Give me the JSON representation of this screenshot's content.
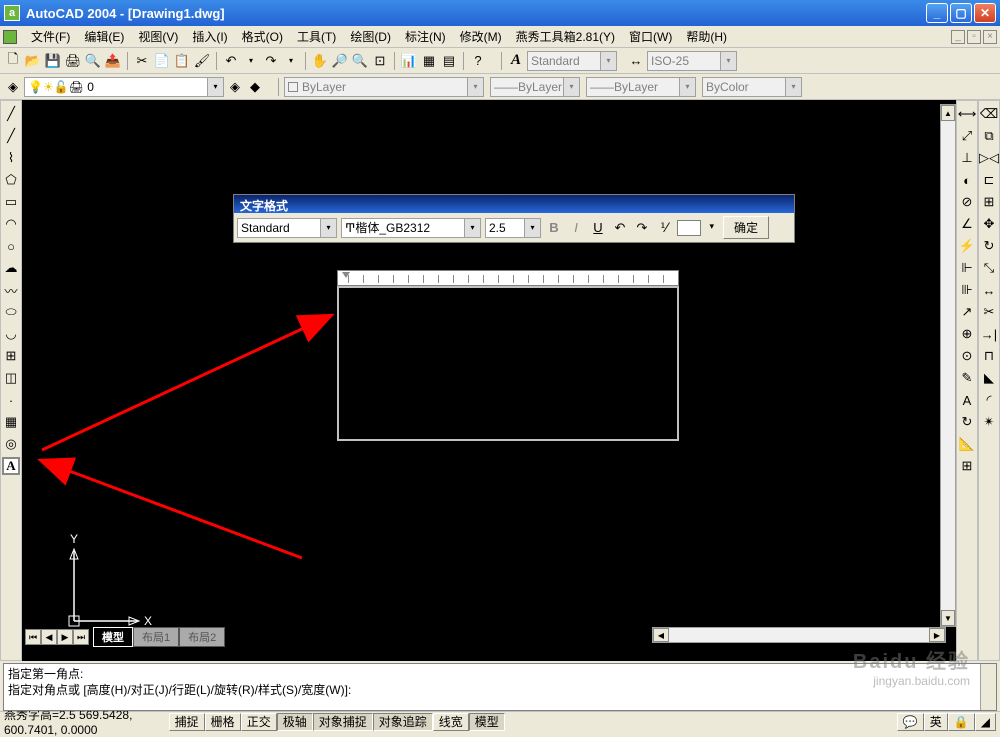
{
  "title": "AutoCAD 2004 - [Drawing1.dwg]",
  "menu": [
    "文件(F)",
    "编辑(E)",
    "视图(V)",
    "插入(I)",
    "格式(O)",
    "工具(T)",
    "绘图(D)",
    "标注(N)",
    "修改(M)",
    "燕秀工具箱2.81(Y)",
    "窗口(W)",
    "帮助(H)"
  ],
  "toolbar1_icons": [
    "new",
    "open",
    "save",
    "print",
    "preview",
    "spell",
    "cut",
    "copy",
    "paste",
    "match",
    "eraser",
    "|",
    "undo",
    "redo",
    "|",
    "pan",
    "zoom-rt",
    "zoom-prev",
    "zoom-win",
    "|",
    "prop",
    "dc",
    "tp",
    "|",
    "help"
  ],
  "style_combo": "Standard",
  "dim_combo": "ISO-25",
  "layer_row": {
    "current": "0",
    "combos": [
      "ByLayer",
      "ByLayer",
      "ByLayer",
      "ByColor"
    ]
  },
  "left_tools": [
    "line",
    "xline",
    "pline",
    "polygon",
    "rect",
    "arc",
    "circle",
    "revcloud",
    "spline",
    "ellipse",
    "ellipse-arc",
    "insert",
    "block",
    "point",
    "hatch",
    "region",
    "table",
    "mtext"
  ],
  "right_tools1": [
    "dist",
    "area",
    "mass",
    "list",
    "id",
    "time",
    "status",
    "setvar",
    "|",
    "dim-lin",
    "dim-ali",
    "dim-rad",
    "dim-dia",
    "dim-ang",
    "dim-ord",
    "dim-base",
    "dim-cont",
    "qleader",
    "tolerance",
    "center"
  ],
  "right_tools2": [
    "erase",
    "copy",
    "mirror",
    "offset",
    "array",
    "move",
    "rotate",
    "scale",
    "stretch",
    "trim",
    "extend",
    "break",
    "chamfer",
    "fillet",
    "explode"
  ],
  "text_format": {
    "title": "文字格式",
    "style": "Standard",
    "font": "楷体_GB2312",
    "height": "2.5",
    "ok": "确定"
  },
  "ucs": {
    "x": "X",
    "y": "Y"
  },
  "tabs": {
    "model": "模型",
    "layout1": "布局1",
    "layout2": "布局2"
  },
  "cmd": {
    "line1": "指定第一角点:",
    "line2": "指定对角点或 [高度(H)/对正(J)/行距(L)/旋转(R)/样式(S)/宽度(W)]:"
  },
  "status": {
    "coords": "燕秀字高=2.5  569.5428, 600.7401, 0.0000",
    "buttons": [
      "捕捉",
      "栅格",
      "正交",
      "极轴",
      "对象捕捉",
      "对象追踪",
      "线宽",
      "模型"
    ]
  },
  "watermark": {
    "brand": "Baidu 经验",
    "url": "jingyan.baidu.com"
  }
}
